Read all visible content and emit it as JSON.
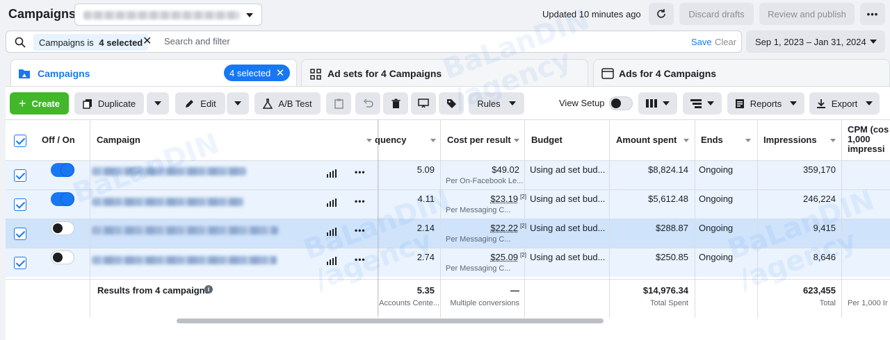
{
  "app": {
    "title": "Campaigns"
  },
  "topbar": {
    "updated": "Updated 10 minutes ago",
    "discard_label": "Discard drafts",
    "review_label": "Review and publish",
    "more_label": "•••"
  },
  "search": {
    "chip_prefix": "Campaigns is ",
    "chip_value": "4 selected",
    "placeholder": "Search and filter",
    "save_label": "Save",
    "clear_label": "Clear"
  },
  "date_range": "Sep 1, 2023 – Jan 31, 2024",
  "tabs": [
    {
      "label": "Campaigns",
      "badge": "4 selected"
    },
    {
      "label": "Ad sets for 4 Campaigns"
    },
    {
      "label": "Ads for 4 Campaigns"
    }
  ],
  "toolbar": {
    "create": "Create",
    "duplicate": "Duplicate",
    "edit": "Edit",
    "ab_test": "A/B Test",
    "rules": "Rules",
    "view_setup": "View Setup",
    "reports": "Reports",
    "export": "Export"
  },
  "table": {
    "columns": [
      "Off / On",
      "Campaign",
      "quency",
      "Cost per result",
      "Budget",
      "Amount spent",
      "Ends",
      "Impressions",
      "CPM (cos",
      "1,000",
      "impressi"
    ],
    "rows": [
      {
        "state": "on",
        "frequency": "5.09",
        "cost": "$49.02",
        "cost_sub": "Per On-Facebook Le...",
        "budget": "Using ad set bud...",
        "spent": "$8,824.14",
        "ends": "Ongoing",
        "impressions": "359,170"
      },
      {
        "state": "on",
        "frequency": "4.11",
        "cost": "$23.19",
        "cost_sup": "[2]",
        "cost_sub": "Per Messaging C...",
        "budget": "Using ad set bud...",
        "spent": "$5,612.48",
        "ends": "Ongoing",
        "impressions": "246,224"
      },
      {
        "state": "off",
        "frequency": "2.14",
        "cost": "$22.22",
        "cost_sup": "[2]",
        "cost_sub": "Per Messaging C...",
        "budget": "Using ad set bud...",
        "spent": "$288.87",
        "ends": "Ongoing",
        "impressions": "9,415"
      },
      {
        "state": "off",
        "frequency": "2.74",
        "cost": "$25.09",
        "cost_sup": "[2]",
        "cost_sub": "Per Messaging C...",
        "budget": "Using ad set bud...",
        "spent": "$250.85",
        "ends": "Ongoing",
        "impressions": "8,646"
      }
    ],
    "totals": {
      "label": "Results from 4 campaigns",
      "frequency": "5.35",
      "frequency_sub": "Accounts Cente...",
      "cost": "—",
      "cost_sub": "Multiple conversions",
      "spent": "$14,976.34",
      "spent_sub": "Total Spent",
      "impressions": "623,455",
      "impressions_sub": "Total",
      "cpm_sub": "Per 1,000 Ir"
    }
  },
  "watermark": {
    "line1": "BaLanDIN",
    "line2": "/agency"
  }
}
